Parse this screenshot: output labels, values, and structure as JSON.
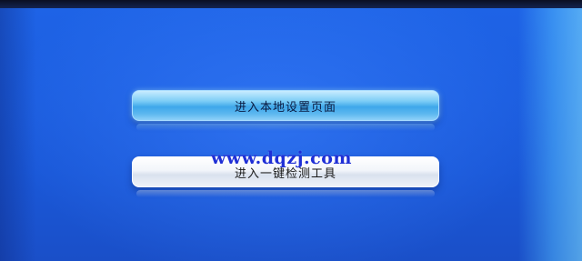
{
  "menu": {
    "items": [
      {
        "label": "进入本地设置页面",
        "state": "focused"
      },
      {
        "label": "进入一键检测工具",
        "state": "normal"
      }
    ]
  },
  "watermark": "www.dqzj.com",
  "colors": {
    "background": "#1c5ee0",
    "focused_button": "#5fb9f0",
    "normal_button": "#f2f5fa",
    "watermark": "#1f2fd6"
  }
}
